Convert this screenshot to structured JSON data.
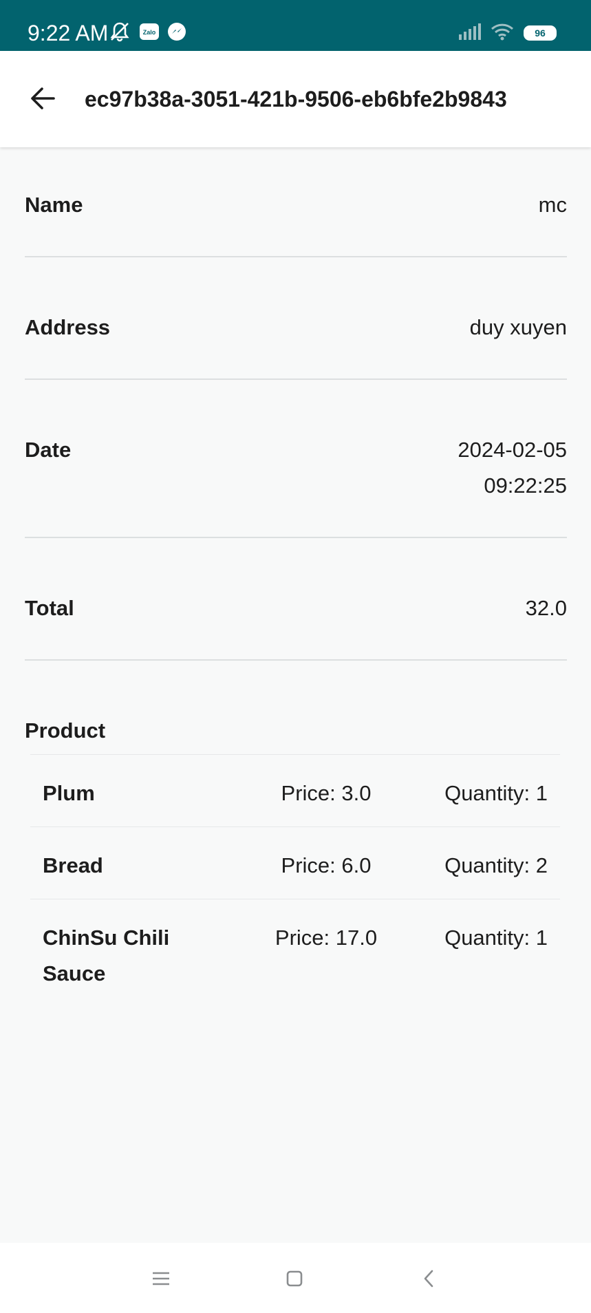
{
  "status_bar": {
    "time": "9:22 AM",
    "battery": "96",
    "icons": [
      "mute-icon",
      "zalo-icon",
      "messenger-icon",
      "signal-icon",
      "wifi-icon",
      "battery-icon"
    ]
  },
  "app_bar": {
    "title": "ec97b38a-3051-421b-9506-eb6bfe2b9843",
    "back_icon": "arrow-left-icon"
  },
  "details": {
    "name_label": "Name",
    "name_value": "mc",
    "address_label": "Address",
    "address_value": "duy xuyen",
    "date_label": "Date",
    "date_value_line1": "2024-02-05",
    "date_value_line2": "09:22:25",
    "total_label": "Total",
    "total_value": "32.0"
  },
  "products": {
    "label": "Product",
    "items": [
      {
        "name": "Plum",
        "price": "Price: 3.0",
        "quantity": "Quantity: 1"
      },
      {
        "name": "Bread",
        "price": "Price: 6.0",
        "quantity": "Quantity: 2"
      },
      {
        "name": "ChinSu Chili Sauce",
        "price": "Price: 17.0",
        "quantity": "Quantity: 1"
      }
    ]
  },
  "nav_bar": {
    "icons": [
      "menu-icon",
      "home-icon",
      "back-icon"
    ]
  },
  "colors": {
    "status_bar": "#02636e",
    "background": "#f8f9f9",
    "divider": "#dcdfe0"
  }
}
